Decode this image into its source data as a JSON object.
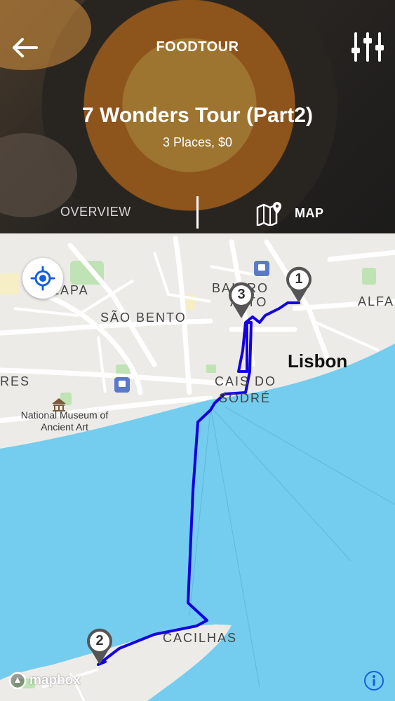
{
  "header": {
    "app_title": "FOODTOUR",
    "tour_title": "7 Wonders Tour (Part2)",
    "tour_subtitle": "3 Places, $0",
    "tabs": {
      "overview": "OVERVIEW",
      "map": "MAP"
    }
  },
  "map": {
    "labels": {
      "lapa": "LAPA",
      "sao_bento": "SÃO BENTO",
      "bairro_alto_1": "BAIRRO",
      "bairro_alto_2": "ALTO",
      "alfama": "ALFA",
      "res": "RES",
      "cais_do_sodre_1": "CAIS DO",
      "cais_do_sodre_2": "SODRÉ",
      "cacilhas": "CACILHAS",
      "city": "Lisbon",
      "museum": "National Museum of Ancient Art"
    },
    "markers": [
      {
        "number": "1"
      },
      {
        "number": "2"
      },
      {
        "number": "3"
      }
    ],
    "attribution": "mapbox",
    "route_color": "#1400e0",
    "water_color": "#74cdee"
  }
}
